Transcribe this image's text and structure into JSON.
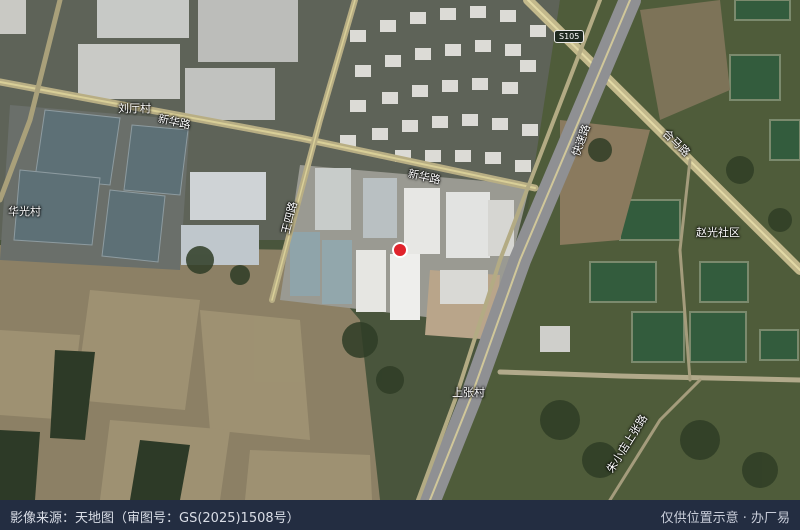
{
  "map": {
    "labels": {
      "liuting": "刘厅村",
      "xinhua_road_w": "新华路",
      "xinhua_road_e": "新华路",
      "wangsi_road": "王四路",
      "huaguang": "华光村",
      "hema_road": "合马路",
      "s105": "S105",
      "expressway": "快速路",
      "zhaoguang": "赵光社区",
      "shangzhang": "上张村",
      "zhuxiaodian_road": "朱小店上张路"
    },
    "marker": {
      "color": "#e0232c",
      "border": "#ffffff"
    }
  },
  "footer": {
    "source": "影像来源：天地图（审图号：GS(2025)1508号）",
    "note": "仅供位置示意 · 办厂易"
  }
}
